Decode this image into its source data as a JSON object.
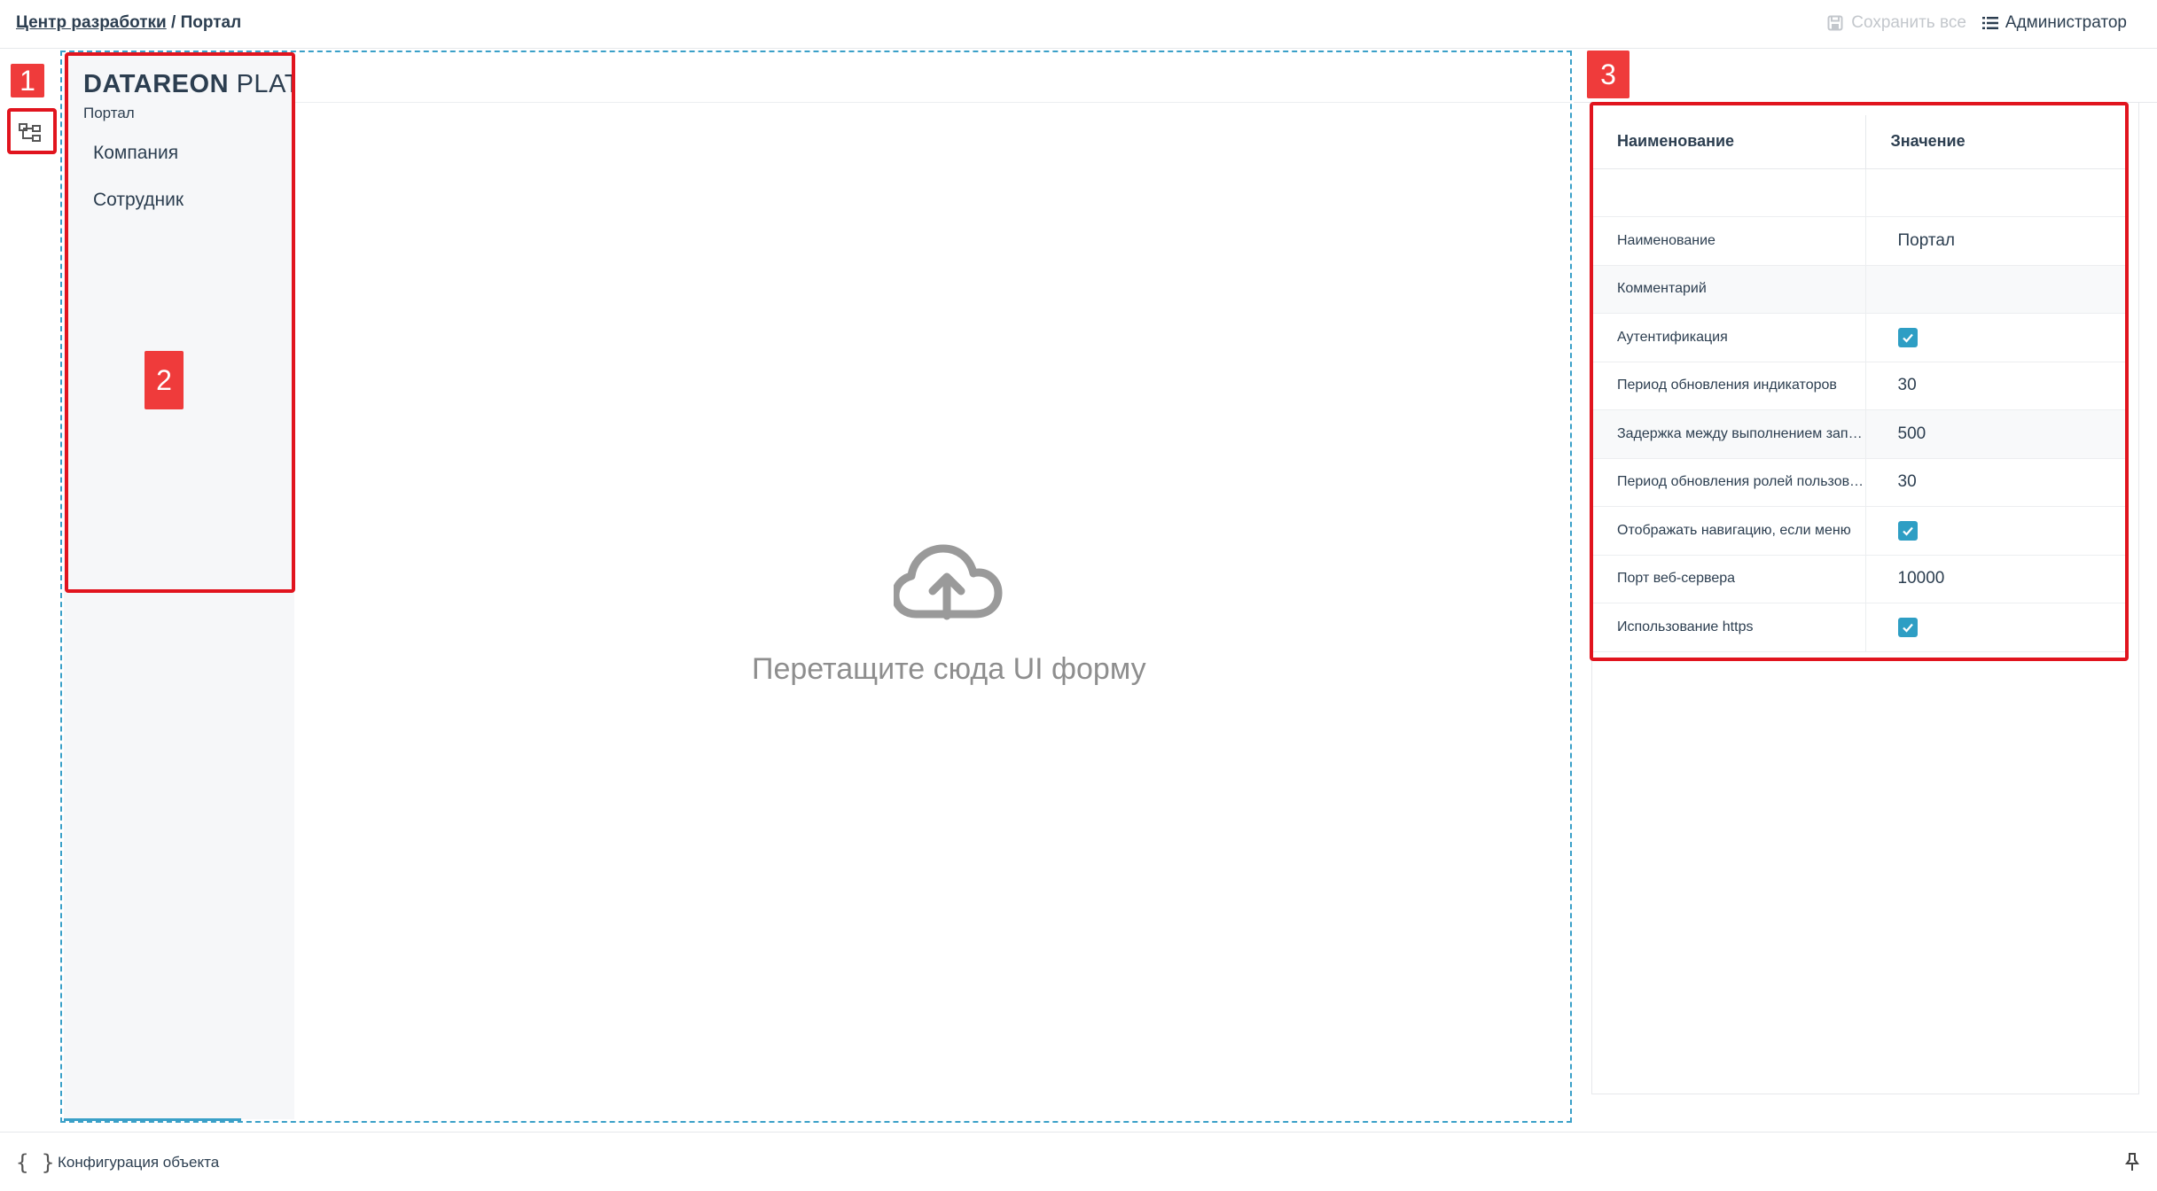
{
  "header": {
    "breadcrumb_link": "Центр разработки",
    "breadcrumb_sep": " / ",
    "breadcrumb_current": "Портал",
    "save_all_label": "Сохранить все",
    "user_label": "Администратор"
  },
  "nav_panel": {
    "brand_bold": "DATAREON",
    "brand_light": "PLATF",
    "subtitle": "Портал",
    "items": [
      {
        "label": "Компания"
      },
      {
        "label": "Сотрудник"
      }
    ]
  },
  "dropzone": {
    "text": "Перетащите сюда UI форму"
  },
  "properties": {
    "col_name": "Наименование",
    "col_value": "Значение",
    "rows": [
      {
        "name": "",
        "value": ""
      },
      {
        "name": "Наименование",
        "value": "Портал"
      },
      {
        "name": "Комментарий",
        "value": ""
      },
      {
        "name": "Аутентификация",
        "checked": true
      },
      {
        "name": "Период обновления индикаторов",
        "value": "30"
      },
      {
        "name": "Задержка между выполнением запросов",
        "value": "500"
      },
      {
        "name": "Период обновления ролей пользователя",
        "value": "30"
      },
      {
        "name": "Отображать навигацию, если меню",
        "checked": true
      },
      {
        "name": "Порт веб-сервера",
        "value": "10000"
      },
      {
        "name": "Использование https",
        "checked": true
      }
    ]
  },
  "annotations": {
    "tag1": "1",
    "tag2": "2",
    "tag3": "3"
  },
  "footer": {
    "icon": "{ }",
    "label": "Конфигурация объекта"
  },
  "colors": {
    "accent": "#2e9ec4",
    "annotation_red": "#e1141e",
    "text": "#2c3e50"
  }
}
